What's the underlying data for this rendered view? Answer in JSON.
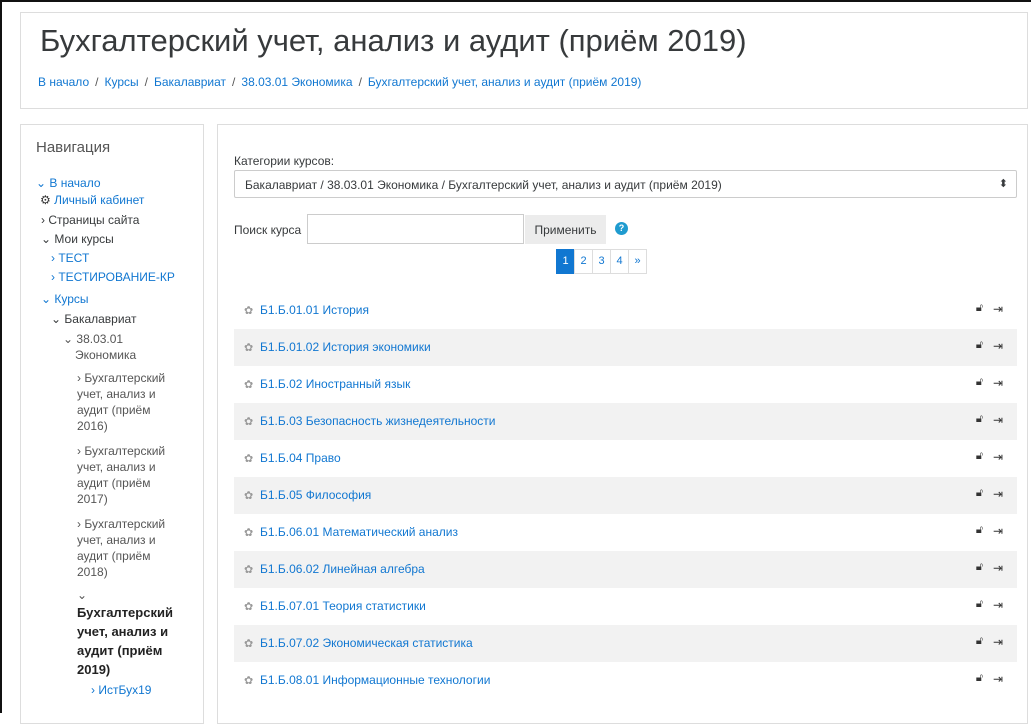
{
  "page": {
    "title": "Бухгалтерский учет, анализ и аудит (приём 2019)"
  },
  "breadcrumb": [
    "В начало",
    "Курсы",
    "Бакалавриат",
    "38.03.01 Экономика",
    "Бухгалтерский учет, анализ и аудит (приём 2019)"
  ],
  "nav": {
    "title": "Навигация",
    "home": "В начало",
    "dashboard": "Личный кабинет",
    "site_pages": "Страницы сайта",
    "my_courses": "Мои курсы",
    "test": "ТЕСТ",
    "testing_kr": "ТЕСТИРОВАНИЕ-КР",
    "courses": "Курсы",
    "bachelor": "Бакалавриат",
    "econ_line1": "38.03.01",
    "econ_line2": "Экономика",
    "buh2016": [
      "Бухгалтерский",
      "учет, анализ и",
      "аудит (приём",
      "2016)"
    ],
    "buh2017": [
      "Бухгалтерский",
      "учет, анализ и",
      "аудит (приём",
      "2017)"
    ],
    "buh2018": [
      "Бухгалтерский",
      "учет, анализ и",
      "аудит (приём",
      "2018)"
    ],
    "buh2019": [
      "Бухгалтерский",
      "учет, анализ и",
      "аудит (приём",
      "2019)"
    ],
    "istbuh": "ИстБух19"
  },
  "categories": {
    "label": "Категории курсов:",
    "selected": "Бакалавриат / 38.03.01 Экономика / Бухгалтерский учет, анализ и аудит (приём 2019)"
  },
  "search": {
    "label": "Поиск курса",
    "value": "",
    "button": "Применить"
  },
  "pagination": [
    "1",
    "2",
    "3",
    "4",
    "»"
  ],
  "courses": [
    "Б1.Б.01.01 История",
    "Б1.Б.01.02 История экономики",
    "Б1.Б.02 Иностранный язык",
    "Б1.Б.03 Безопасность жизнедеятельности",
    "Б1.Б.04 Право",
    "Б1.Б.05 Философия",
    "Б1.Б.06.01 Математический анализ",
    "Б1.Б.06.02 Линейная алгебра",
    "Б1.Б.07.01 Теория статистики",
    "Б1.Б.07.02 Экономическая статистика",
    "Б1.Б.08.01 Информационные технологии"
  ],
  "colors": {
    "link": "#1177d1",
    "row_alt": "#f2f2f2"
  }
}
